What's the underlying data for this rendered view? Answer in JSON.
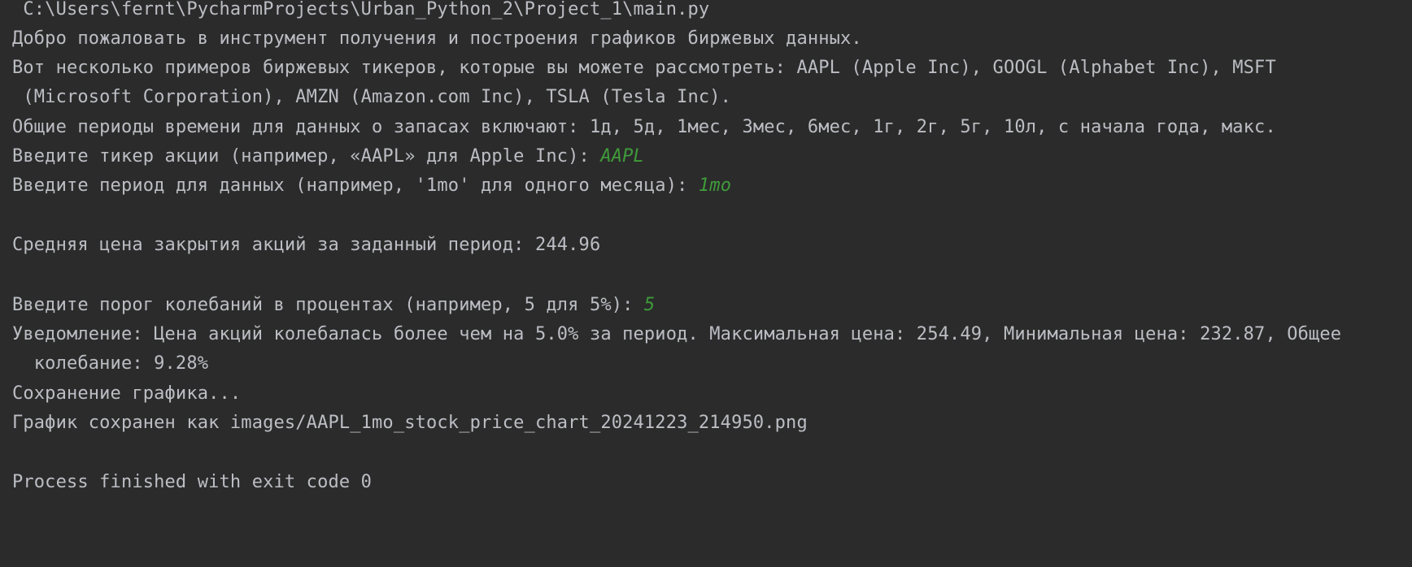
{
  "console": {
    "command_line": " C:\\Users\\fernt\\PycharmProjects\\Urban_Python_2\\Project_1\\main.py",
    "welcome": "Добро пожаловать в инструмент получения и построения графиков биржевых данных.",
    "tickers_line1": "Вот несколько примеров биржевых тикеров, которые вы можете рассмотреть: AAPL (Apple Inc), GOOGL (Alphabet Inc), MSFT",
    "tickers_line2": " (Microsoft Corporation), AMZN (Amazon.com Inc), TSLA (Tesla Inc).",
    "periods": "Общие периоды времени для данных о запасах включают: 1д, 5д, 1мес, 3мес, 6мес, 1г, 2г, 5г, 10л, с начала года, макс.",
    "ticker_prompt": "Введите тикер акции (например, «AAPL» для Apple Inc): ",
    "ticker_input": "AAPL",
    "period_prompt": "Введите период для данных (например, '1mo' для одного месяца): ",
    "period_input": "1mo",
    "average_price": "Средняя цена закрытия акций за заданный период: 244.96",
    "threshold_prompt": "Введите порог колебаний в процентах (например, 5 для 5%): ",
    "threshold_input": "5",
    "notice_line1": "Уведомление: Цена акций колебалась более чем на 5.0% за период. Максимальная цена: 254.49, Минимальная цена: 232.87, Общее",
    "notice_line2": "  колебание: 9.28%",
    "saving": "Сохранение графика...",
    "saved": "График сохранен как images/AAPL_1mo_stock_price_chart_20241223_214950.png",
    "exit": "Process finished with exit code 0"
  }
}
